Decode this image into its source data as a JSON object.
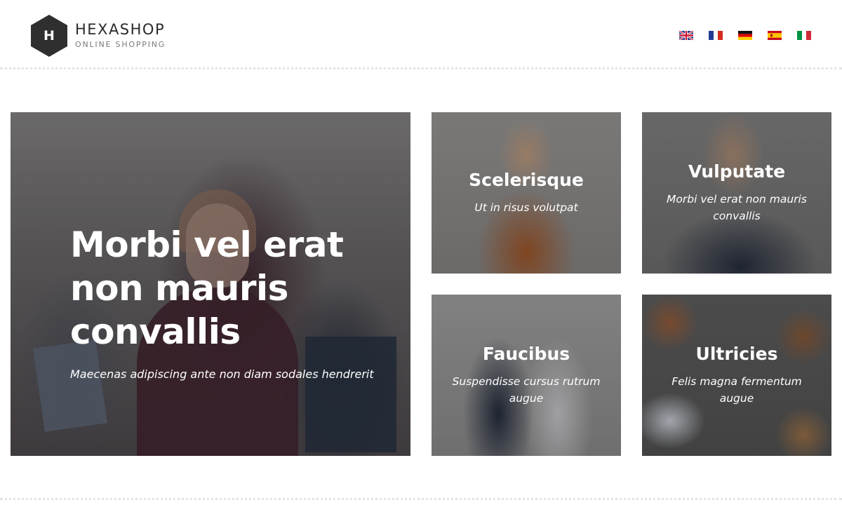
{
  "brand": {
    "logo_letter": "H",
    "name": "HEXASHOP",
    "tagline": "ONLINE SHOPPING"
  },
  "languages": [
    {
      "code": "en",
      "icon": "uk-flag-icon"
    },
    {
      "code": "fr",
      "icon": "france-flag-icon"
    },
    {
      "code": "de",
      "icon": "germany-flag-icon"
    },
    {
      "code": "es",
      "icon": "spain-flag-icon"
    },
    {
      "code": "it",
      "icon": "italy-flag-icon"
    }
  ],
  "hero": {
    "title": "Morbi vel erat non mauris convallis",
    "subtitle": "Maecenas adipiscing ante non diam sodales hendrerit"
  },
  "tiles": [
    {
      "title": "Scelerisque",
      "subtitle": "Ut in risus volutpat"
    },
    {
      "title": "Vulputate",
      "subtitle": "Morbi vel erat non mauris convallis"
    },
    {
      "title": "Faucibus",
      "subtitle": "Suspendisse cursus rutrum augue"
    },
    {
      "title": "Ultricies",
      "subtitle": "Felis magna fermentum augue"
    }
  ],
  "colors": {
    "logo_hex": "#2f2f2f",
    "text_dark": "#2a2a2a",
    "divider": "#e4e4e4"
  }
}
